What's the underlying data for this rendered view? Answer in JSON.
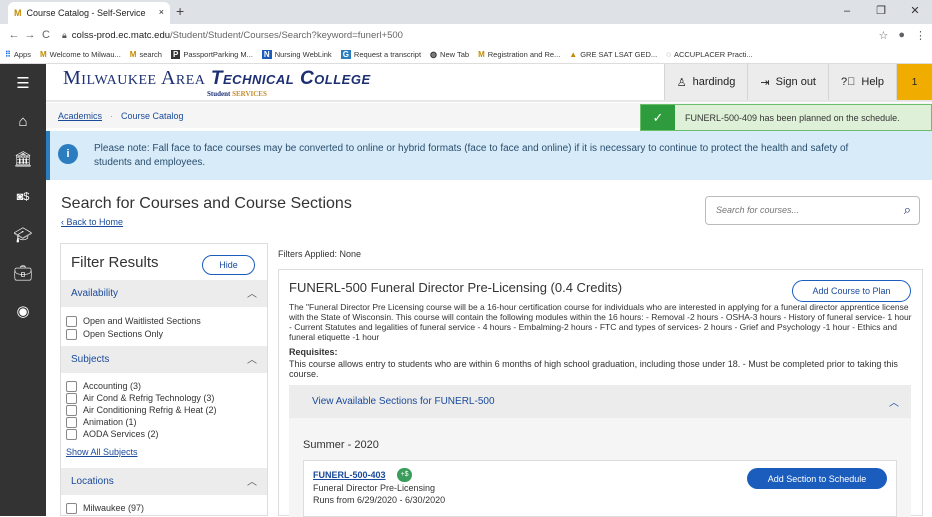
{
  "browser": {
    "tab_title": "Course Catalog - Self-Service",
    "tab_close": "×",
    "new_tab": "+",
    "url_host": "colss-prod.ec.matc.edu",
    "url_path": "/Student/Student/Courses/Search?keyword=funerl+500",
    "window_controls": [
      "–",
      "❐",
      "✕"
    ],
    "bookmarks": [
      {
        "icon": "apps-icon",
        "label": "Apps"
      },
      {
        "icon": "m-logo-icon",
        "label": "Welcome to Milwau..."
      },
      {
        "icon": "m-logo-icon",
        "label": "search"
      },
      {
        "icon": "parking-icon",
        "label": "PassportParking M..."
      },
      {
        "icon": "nursing-icon",
        "label": "Nursing WebLink"
      },
      {
        "icon": "g-icon",
        "label": "Request a transcript"
      },
      {
        "icon": "globe-icon",
        "label": "New Tab"
      },
      {
        "icon": "m-logo-icon",
        "label": "Registration and Re..."
      },
      {
        "icon": "grad-icon",
        "label": "GRE SAT LSAT GED..."
      },
      {
        "icon": "accuplacer-icon",
        "label": "ACCUPLACER Practi..."
      }
    ]
  },
  "header": {
    "logo_main": "Milwaukee Area",
    "logo_emph": "Technical College",
    "logo_sub1": "Student",
    "logo_sub2": "SERVICES",
    "user": "hardindg",
    "sign_out": "Sign out",
    "help": "Help",
    "notifications": "1"
  },
  "breadcrumb": {
    "academics": "Academics",
    "catalog": "Course Catalog"
  },
  "toast": {
    "message": "FUNERL-500-409 has been planned on the schedule."
  },
  "banner": {
    "icon": "i",
    "text": "Please note: Fall face to face courses may be converted to online or hybrid formats (face to face and online) if it is necessary to continue to protect the health and safety of students and employees."
  },
  "page": {
    "title": "Search for Courses and Course Sections",
    "back": "Back to Home",
    "search_placeholder": "Search for courses..."
  },
  "filters": {
    "title": "Filter Results",
    "hide": "Hide",
    "availability": {
      "label": "Availability",
      "options": [
        "Open and Waitlisted Sections",
        "Open Sections Only"
      ]
    },
    "subjects": {
      "label": "Subjects",
      "options": [
        "Accounting (3)",
        "Air Cond & Refrig Technology (3)",
        "Air Conditioning Refrig & Heat (2)",
        "Animation (1)",
        "AODA Services (2)"
      ],
      "show_all": "Show All Subjects"
    },
    "locations": {
      "label": "Locations",
      "options": [
        "Milwaukee (97)"
      ]
    }
  },
  "results": {
    "applied": "Filters Applied: None",
    "course_title": "FUNERL-500 Funeral Director Pre-Licensing (0.4 Credits)",
    "add_to_plan": "Add Course to Plan",
    "description": "The \"Funeral Director Pre Licensing course will be a 16-hour certification course for individuals who are interested in applying for a funeral director apprentice license with the State of Wisconsin. This course will contain the following modules within the 16 hours: - Removal -2 hours - OSHA-3 hours - History of funeral service- 1 hour - Current Statutes and legalities of funeral service - 4 hours - Embalming-2 hours - FTC and types of services- 2 hours - Grief and Psychology -1 hour - Ethics and funeral etiquette -1 hour",
    "requisites_label": "Requisites:",
    "requisites_text": "This course allows entry to students who are within 6 months of high school graduation, including those under 18. - Must be completed prior to taking this course.",
    "view_sections": "View Available Sections for FUNERL-500",
    "term": "Summer - 2020",
    "section": {
      "id": "FUNERL-500-403",
      "fee_badge": "+$",
      "name": "Funeral Director Pre-Licensing",
      "dates": "Runs from 6/29/2020 - 6/30/2020",
      "add": "Add Section to Schedule"
    }
  }
}
